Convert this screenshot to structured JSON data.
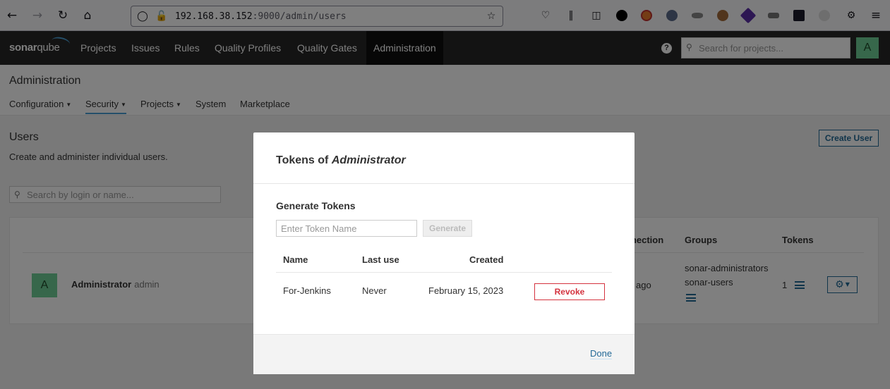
{
  "browser": {
    "url_host": "192.168.38.152",
    "url_rest": ":9000/admin/users"
  },
  "header": {
    "logo_bold": "sonar",
    "logo_rest": "qube",
    "nav": [
      "Projects",
      "Issues",
      "Rules",
      "Quality Profiles",
      "Quality Gates",
      "Administration"
    ],
    "search_placeholder": "Search for projects...",
    "avatar_letter": "A"
  },
  "admin": {
    "title": "Administration",
    "tabs": [
      "Configuration",
      "Security",
      "Projects",
      "System",
      "Marketplace"
    ]
  },
  "users": {
    "title": "Users",
    "description": "Create and administer individual users.",
    "create_button": "Create User",
    "search_placeholder": "Search by login or name...",
    "columns": {
      "last_connection": "nnection",
      "groups": "Groups",
      "tokens": "Tokens"
    },
    "row": {
      "avatar_letter": "A",
      "name": "Administrator",
      "login": "admin",
      "last_connection": "ago",
      "groups": [
        "sonar-administrators",
        "sonar-users"
      ],
      "token_count": "1"
    }
  },
  "modal": {
    "title_prefix": "Tokens of ",
    "title_user": "Administrator",
    "generate_title": "Generate Tokens",
    "token_placeholder": "Enter Token Name",
    "generate_button": "Generate",
    "columns": {
      "name": "Name",
      "last_use": "Last use",
      "created": "Created"
    },
    "tokens": [
      {
        "name": "For-Jenkins",
        "last_use": "Never",
        "created": "February 15, 2023",
        "action": "Revoke"
      }
    ],
    "done": "Done"
  },
  "colors": {
    "accent": "#236a97",
    "danger": "#d4333f",
    "avatar": "#6fcf97",
    "header_bg": "#262626"
  }
}
